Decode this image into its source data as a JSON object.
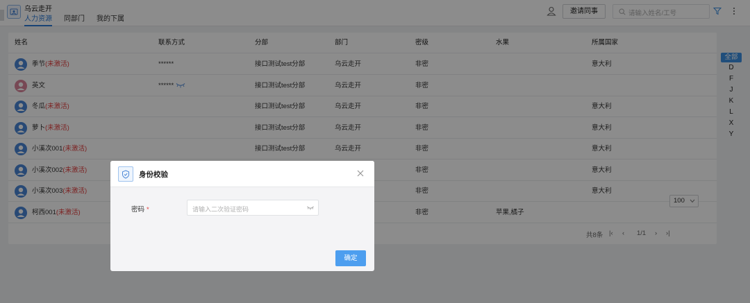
{
  "header": {
    "org_name": "乌云走开",
    "tabs": [
      {
        "label": "人力资源",
        "active": true
      },
      {
        "label": "同部门",
        "active": false
      },
      {
        "label": "我的下属",
        "active": false
      }
    ],
    "invite_label": "邀请同事",
    "search_placeholder": "请输入姓名/工号"
  },
  "table": {
    "columns": [
      "姓名",
      "联系方式",
      "分部",
      "部门",
      "密级",
      "水果",
      "所属国家"
    ],
    "rows": [
      {
        "name": "季节",
        "status": "(未激活)",
        "contact": "******",
        "branch": "接口测试test分部",
        "dept": "乌云走开",
        "level": "非密",
        "fruit": "",
        "country": "意大利",
        "avatar": "blue"
      },
      {
        "name": "英文",
        "status": "",
        "contact": "******",
        "branch": "接口测试test分部",
        "dept": "乌云走开",
        "level": "非密",
        "fruit": "",
        "country": "",
        "avatar": "pink"
      },
      {
        "name": "冬瓜",
        "status": "(未激活)",
        "contact": "",
        "branch": "接口测试test分部",
        "dept": "乌云走开",
        "level": "非密",
        "fruit": "",
        "country": "意大利",
        "avatar": "blue"
      },
      {
        "name": "萝卜",
        "status": "(未激活)",
        "contact": "",
        "branch": "接口测试test分部",
        "dept": "乌云走开",
        "level": "非密",
        "fruit": "",
        "country": "意大利",
        "avatar": "blue"
      },
      {
        "name": "小溪次001",
        "status": "(未激活)",
        "contact": "",
        "branch": "接口测试test分部",
        "dept": "乌云走开",
        "level": "非密",
        "fruit": "",
        "country": "意大利",
        "avatar": "blue"
      },
      {
        "name": "小溪次002",
        "status": "(未激活)",
        "contact": "",
        "branch": "",
        "dept": "",
        "level": "非密",
        "fruit": "",
        "country": "意大利",
        "avatar": "blue"
      },
      {
        "name": "小溪次003",
        "status": "(未激活)",
        "contact": "",
        "branch": "",
        "dept": "",
        "level": "非密",
        "fruit": "",
        "country": "意大利",
        "avatar": "blue"
      },
      {
        "name": "柯西001",
        "status": "(未激活)",
        "contact": "",
        "branch": "",
        "dept": "",
        "level": "非密",
        "fruit": "苹果,橘子",
        "country": "",
        "avatar": "blue"
      }
    ]
  },
  "pagination": {
    "total": "共8条",
    "page": "1/1",
    "page_size": "100"
  },
  "alpha_index": {
    "all": "全部",
    "letters": [
      "D",
      "F",
      "J",
      "K",
      "L",
      "X",
      "Y"
    ]
  },
  "modal": {
    "title": "身份校验",
    "password_label": "密码",
    "required_mark": "*",
    "password_placeholder": "请输入二次验证密码",
    "confirm_label": "确定"
  },
  "colors": {
    "accent": "#2d7ad6",
    "primary_button": "#4d9eef",
    "inactive_text": "#e23c3c",
    "avatar_blue": "#4a86d6",
    "avatar_pink": "#d9839a"
  }
}
